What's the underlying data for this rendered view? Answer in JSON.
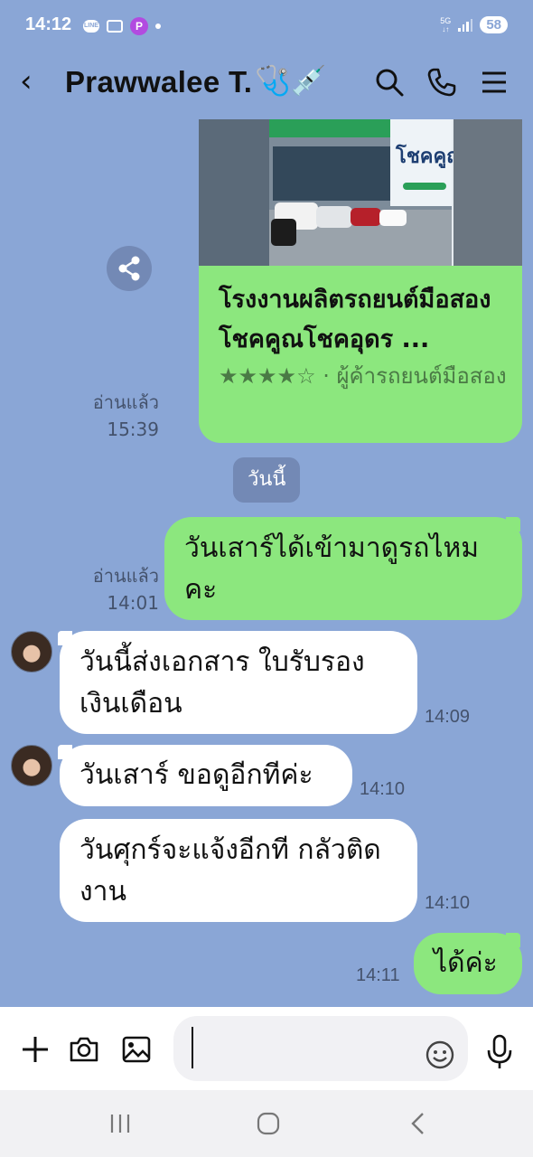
{
  "status": {
    "time": "14:12",
    "net": "5G",
    "battery": "58"
  },
  "header": {
    "title": "Prawwalee T.",
    "deco": "🩺💉"
  },
  "messages": {
    "card": {
      "title": "โรงงานผลิตรถยนต์มือสอง โชคคูณโชคอุดร ...",
      "rating": "★★★★☆",
      "subtitle": "· ผู้ค้ารถยนต์มือสอง",
      "read_label": "อ่านแล้ว",
      "time": "15:39",
      "image_text": "โชคคูณ"
    },
    "date_divider": "วันนี้",
    "m1": {
      "text": "วันเสาร์ได้เข้ามาดูรถไหมคะ",
      "read_label": "อ่านแล้ว",
      "time": "14:01"
    },
    "m2": {
      "text": "วันนี้ส่งเอกสาร ใบรับรองเงินเดือน",
      "time": "14:09"
    },
    "m3": {
      "text": "วันเสาร์ ขอดูอีกทีค่ะ",
      "time": "14:10"
    },
    "m4": {
      "text": "วันศุกร์จะแจ้งอีกที กลัวติดงาน",
      "time": "14:10"
    },
    "m5": {
      "text": "ได้ค่ะ",
      "time": "14:11"
    }
  },
  "colors": {
    "chat_bg": "#8aa6d6",
    "outgoing": "#8ce77e",
    "incoming": "#ffffff"
  },
  "icons": [
    "back-icon",
    "search-icon",
    "phone-icon",
    "menu-icon",
    "share-icon",
    "plus-icon",
    "camera-icon",
    "image-icon",
    "emoji-icon",
    "mic-icon",
    "recents-icon",
    "home-icon",
    "nav-back-icon"
  ]
}
